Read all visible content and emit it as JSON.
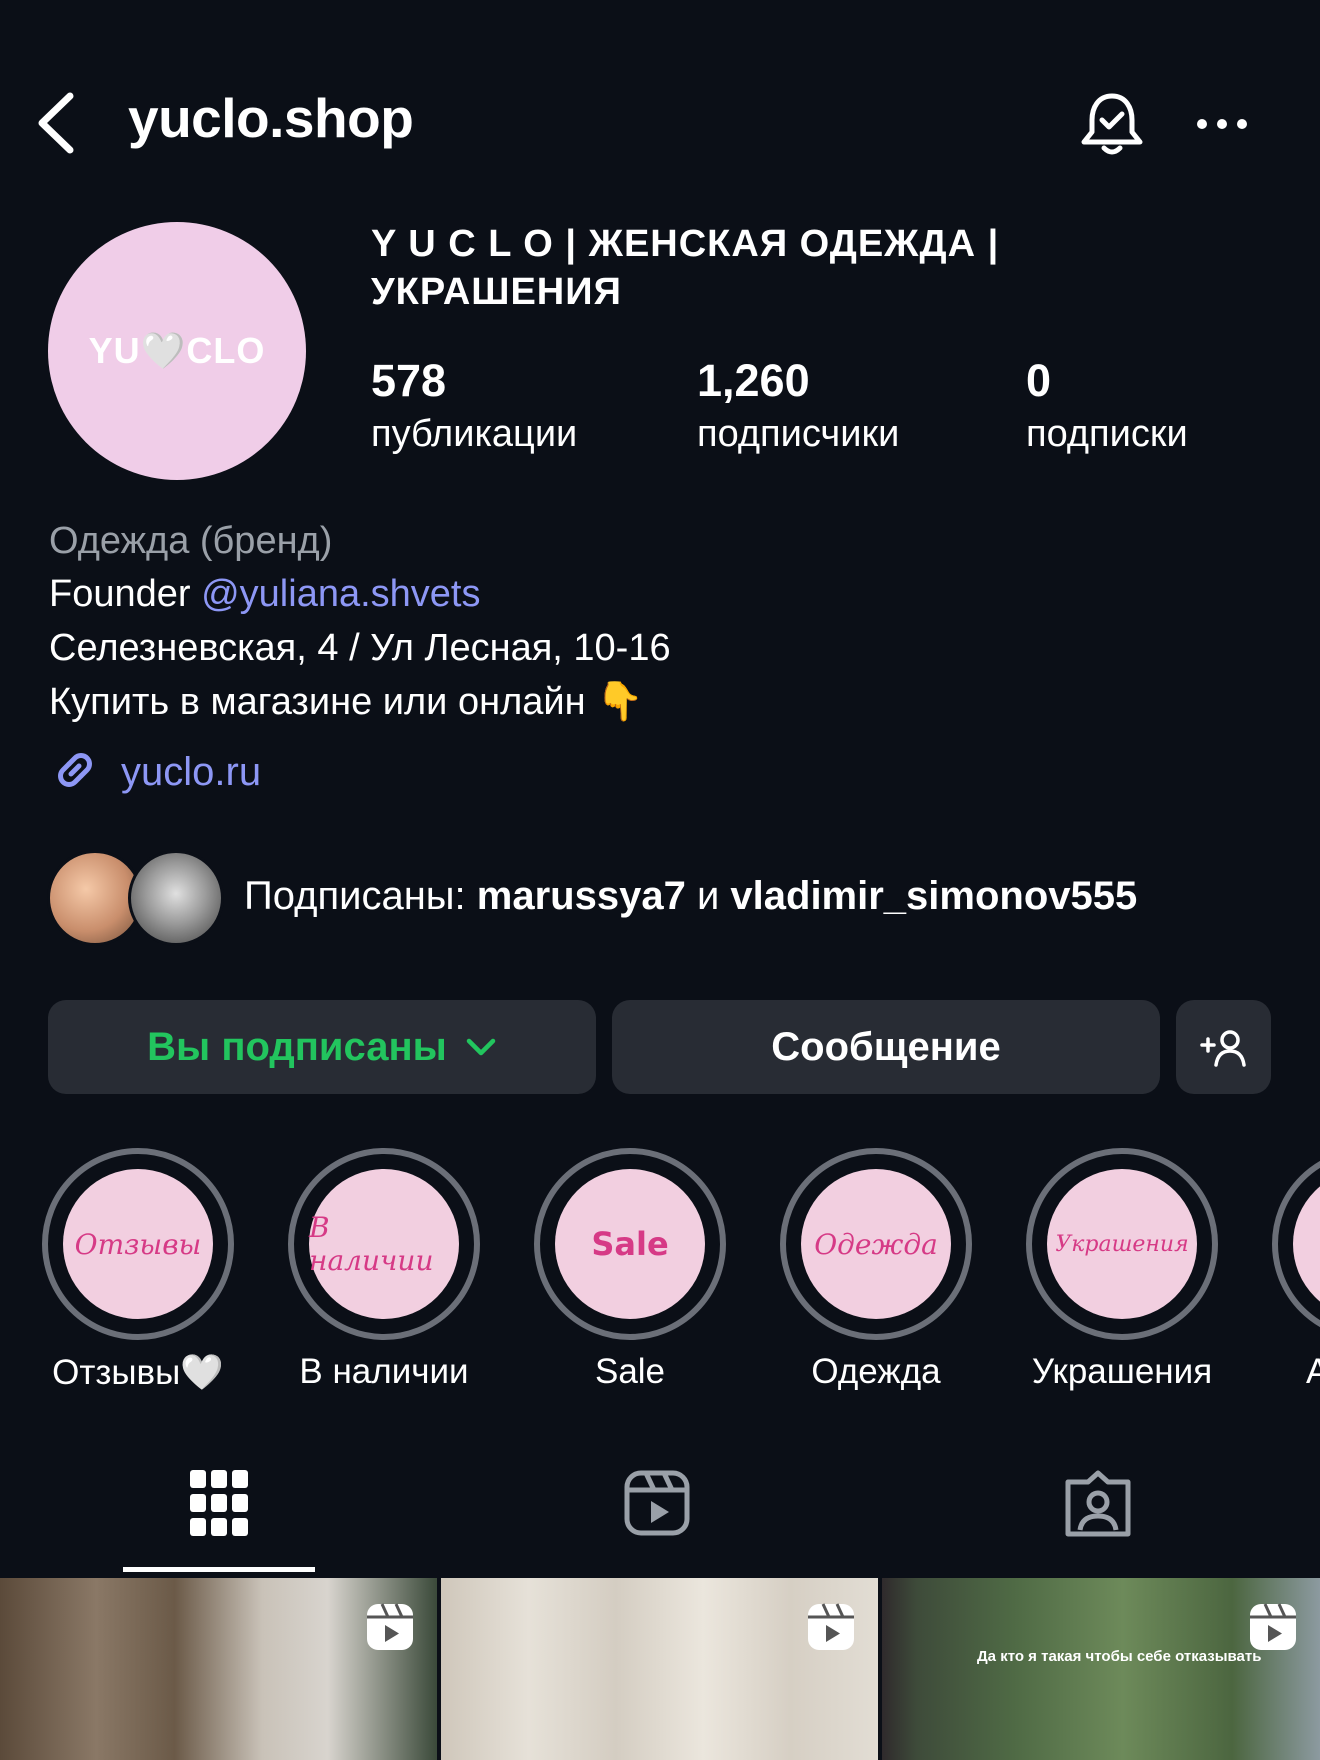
{
  "header": {
    "username": "yuclo.shop"
  },
  "profile": {
    "avatar_text": "YU🤍CLO",
    "display_name": "Y U C L O  |  ЖЕНСКАЯ ОДЕЖДА  |  УКРАШЕНИЯ",
    "stats": [
      {
        "value": "578",
        "label": "публикации"
      },
      {
        "value": "1,260",
        "label": "подписчики"
      },
      {
        "value": "0",
        "label": "подписки"
      }
    ],
    "bio": {
      "category": "Одежда (бренд)",
      "founder_prefix": "Founder ",
      "founder_handle": "@yuliana.shvets",
      "address": "Селезневская, 4 / Ул Лесная, 10-16",
      "cta": "Купить в магазине или онлайн 👇"
    },
    "link": "yuclo.ru"
  },
  "followed_by": {
    "prefix": "Подписаны: ",
    "user1": "marussya7",
    "joiner": " и ",
    "user2": "vladimir_simonov555"
  },
  "actions": {
    "following_label": "Вы подписаны",
    "message_label": "Сообщение"
  },
  "highlights": [
    {
      "cover": "Отзывы",
      "label": "Отзывы🤍"
    },
    {
      "cover": "В наличии",
      "label": "В наличии"
    },
    {
      "cover": "Sale",
      "label": "Sale"
    },
    {
      "cover": "Одежда",
      "label": "Одежда"
    },
    {
      "cover": "Украшения",
      "label": "Украшения"
    },
    {
      "cover": "",
      "label": "А"
    }
  ],
  "posts": [
    {
      "type": "reel",
      "caption": ""
    },
    {
      "type": "reel",
      "caption": ""
    },
    {
      "type": "reel",
      "caption": "Да кто я такая чтобы себе отказывать"
    }
  ],
  "colors": {
    "background": "#0b0f17",
    "accent_link": "#8d97f5",
    "following_green": "#22c55e",
    "button_bg": "#282c34",
    "highlight_pink": "#d63a86"
  },
  "icons": [
    "back-arrow-icon",
    "bell-check-icon",
    "more-dots-icon",
    "link-icon",
    "chevron-down-icon",
    "add-person-icon",
    "grid-icon",
    "reels-icon",
    "tagged-icon",
    "reel-badge-icon"
  ]
}
